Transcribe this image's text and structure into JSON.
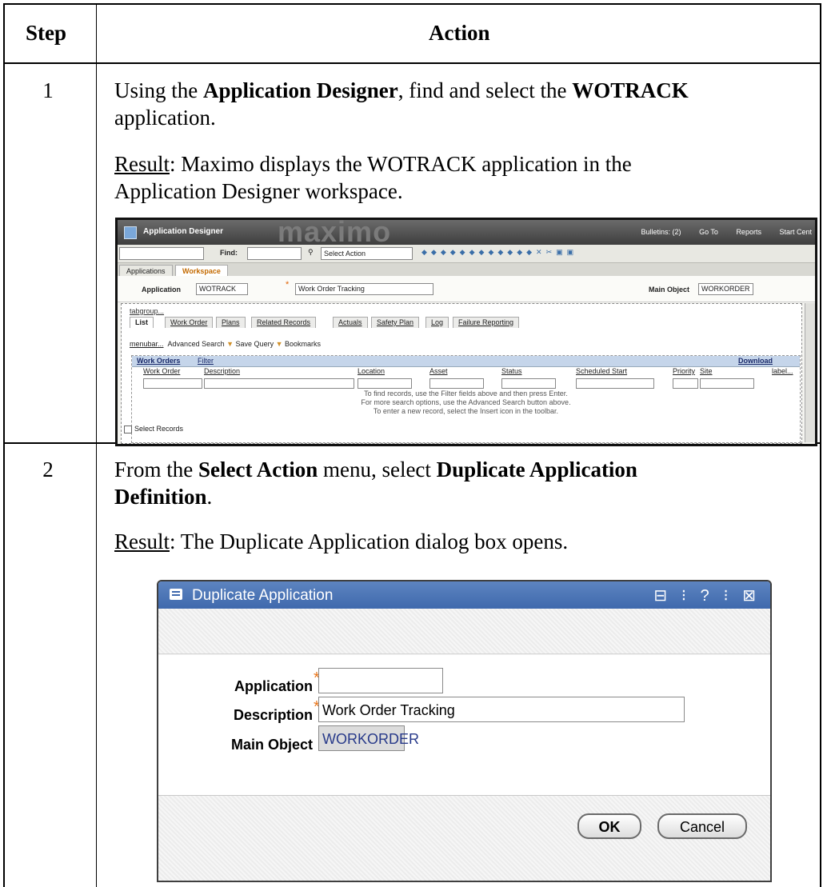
{
  "table": {
    "headers": {
      "step": "Step",
      "action": "Action"
    },
    "rows": [
      {
        "step": "1",
        "line1_a": "Using the ",
        "line1_b": "Application Designer",
        "line1_c": ", find and select the ",
        "line1_d": "WOTRACK",
        "line2": "application.",
        "result_label": "Result",
        "result_line1": ": Maximo displays the WOTRACK application in the",
        "result_line2": "Application Designer workspace."
      },
      {
        "step": "2",
        "line1_a": "From the ",
        "line1_b": "Select Action",
        "line1_c": " menu, select ",
        "line1_d": "Duplicate Application",
        "line2_bold": "Definition",
        "line2_end": ".",
        "result_label": "Result",
        "result_text": ": The Duplicate Application dialog box opens."
      }
    ]
  },
  "screenshot1": {
    "title": "Application Designer",
    "brand": "maximo",
    "header_links": [
      "Bulletins: (2)",
      "Go To",
      "Reports",
      "Start Cent"
    ],
    "find_label": "Find:",
    "select_action": "Select Action",
    "tabs": [
      "Applications",
      "Workspace"
    ],
    "application_label": "Application",
    "application_value": "WOTRACK",
    "description_value": "Work Order Tracking",
    "main_object_label": "Main Object",
    "main_object_value": "WORKORDER",
    "tabgroup": "tabgroup...",
    "inner_tabs": [
      "List",
      "Work Order",
      "Plans",
      "Related Records",
      "Actuals",
      "Safety Plan",
      "Log",
      "Failure Reporting"
    ],
    "menubar": "menubar...",
    "menu_items": [
      "Advanced Search",
      "Save Query",
      "Bookmarks"
    ],
    "table_title": "Work Orders",
    "filter": "Filter",
    "download": "Download",
    "columns": [
      "Work Order",
      "Description",
      "Location",
      "Asset",
      "Status",
      "Scheduled Start",
      "Priority",
      "Site",
      "label..."
    ],
    "hints": [
      "To find records, use the Filter fields above and then press Enter.",
      "For more search options, use the Advanced Search button above.",
      "To enter a new record, select the Insert icon in the toolbar."
    ],
    "select_records": "Select Records"
  },
  "dialog": {
    "title": "Duplicate Application",
    "controls": "⊟ ⁝ ? ⁝ ⊠",
    "application_label": "Application",
    "application_value": "",
    "description_label": "Description",
    "description_value": "Work Order Tracking",
    "main_object_label": "Main Object",
    "main_object_value": "WORKORDER",
    "ok": "OK",
    "cancel": "Cancel"
  }
}
